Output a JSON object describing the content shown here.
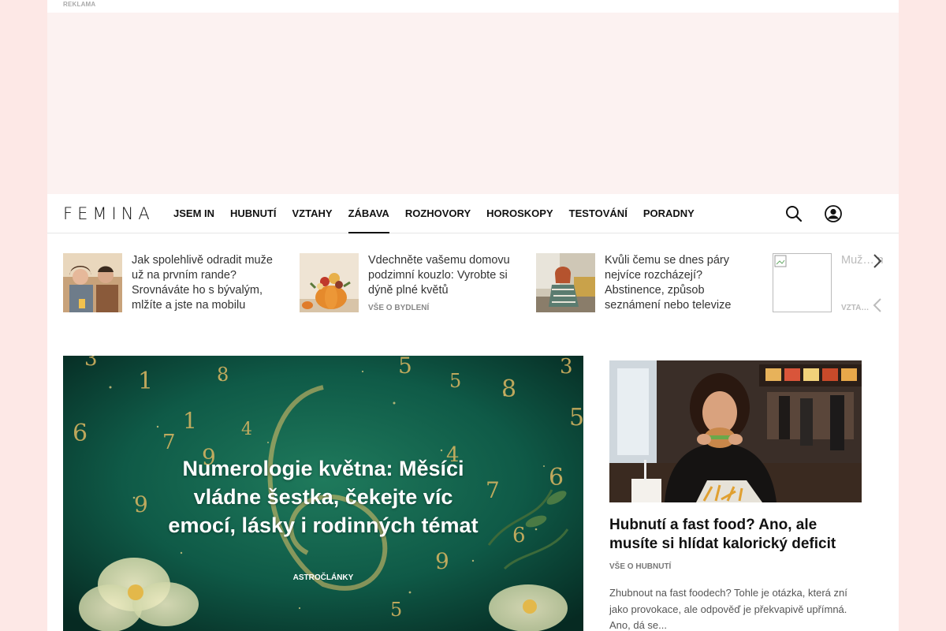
{
  "ad": {
    "label": "REKLAMA"
  },
  "header": {
    "logo": "FEMINA",
    "menu": [
      "JSEM IN",
      "HUBNUTÍ",
      "VZTAHY",
      "ZÁBAVA",
      "ROZHOVORY",
      "HOROSKOPY",
      "TESTOVÁNÍ",
      "PORADNY"
    ],
    "active_menu": "ZÁBAVA"
  },
  "strip": [
    {
      "title": "Jak spolehlivě odradit muže už na prvním rande? Srovnáváte ho s bývalým, mlžíte a jste na mobilu",
      "category": ""
    },
    {
      "title": "Vdechněte vašemu domovu podzimní kouzlo: Vyrobte si dýně plné květů",
      "category": "VŠE O BYDLENÍ"
    },
    {
      "title": "Kvůli čemu se dnes páry nejvíce rozcházejí? Abstinence, způsob seznámení nebo televize",
      "category": ""
    },
    {
      "title": "Muž… min… ple…",
      "category": "VZTA…"
    }
  ],
  "hero": {
    "title": "Numerologie května: Měsíci vládne šestka, čekejte víc emocí, lásky i rodinných témat",
    "category": "ASTROČLÁNKY",
    "numbers": [
      "1",
      "8",
      "3",
      "5",
      "3",
      "8",
      "5",
      "6",
      "7",
      "1",
      "4",
      "4",
      "9",
      "5",
      "7",
      "6",
      "9",
      "9",
      "6",
      "5"
    ]
  },
  "side": {
    "title": "Hubnutí a fast food? Ano, ale musíte si hlídat kalorický deficit",
    "category": "VŠE O HUBNUTÍ",
    "excerpt": "Zhubnout na fast foodech? Tohle je otázka, která zní jako provokace, ale odpověď je překvapivě upřímná. Ano, dá se..."
  },
  "colors": {
    "page_bg": "#fde8e6",
    "ad_bg": "#fcf2f1",
    "hero_green": "#0f5a47"
  },
  "icons": [
    "search-icon",
    "user-icon",
    "chevron-right-icon",
    "chevron-left-icon"
  ]
}
